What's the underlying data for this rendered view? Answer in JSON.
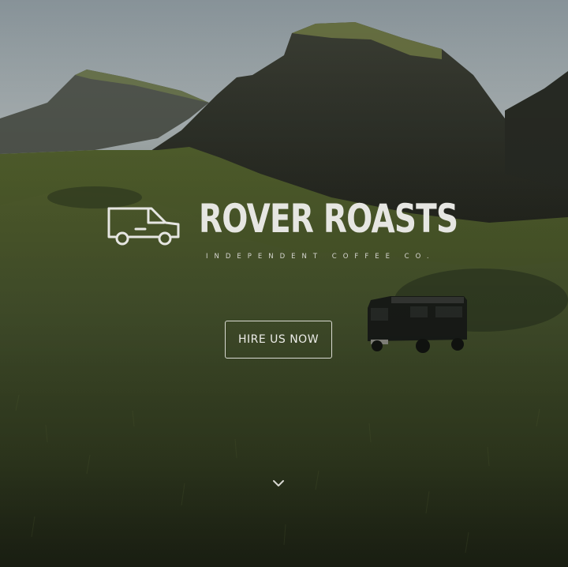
{
  "hero": {
    "brand_name": "ROVER ROASTS",
    "tagline": "INDEPENDENT COFFEE CO.",
    "cta_label": "HIRE US NOW"
  },
  "icons": {
    "logo": "van-outline-icon",
    "scroll": "chevron-down-icon"
  },
  "colors": {
    "sky": "#a9b3b6",
    "mountain": "#2b2e29",
    "grass": "#4b5a2c",
    "text": "#e6e6e2"
  }
}
